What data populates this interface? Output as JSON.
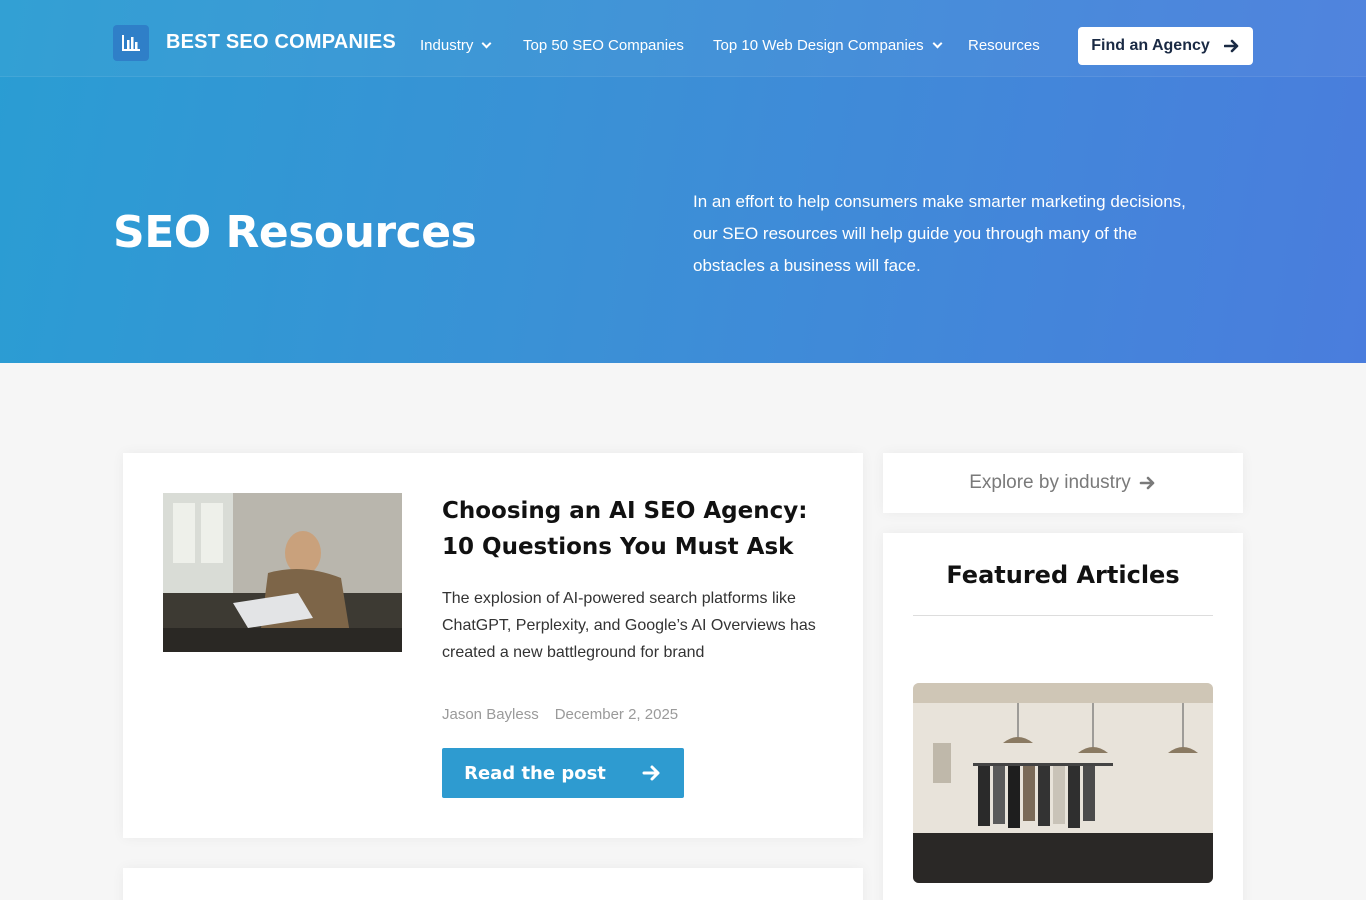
{
  "brand": {
    "name": "BEST SEO COMPANIES"
  },
  "nav": {
    "items": [
      {
        "label": "Industry",
        "dropdown": true
      },
      {
        "label": "Top 50 SEO Companies",
        "dropdown": false
      },
      {
        "label": "Top 10 Web Design Companies",
        "dropdown": true
      },
      {
        "label": "Resources",
        "dropdown": false
      }
    ],
    "cta_label": "Find an Agency"
  },
  "hero": {
    "title": "SEO Resources",
    "description": "In an effort to help consumers make smarter marketing decisions, our SEO resources will help guide you through many of the obstacles a business will face."
  },
  "post": {
    "title": "Choosing an AI SEO Agency: 10 Questions You Must Ask",
    "excerpt": "The explosion of AI-powered search platforms like ChatGPT, Perplexity, and Google’s AI Overviews has created a new battleground for brand",
    "author": "Jason Bayless",
    "date": "December 2, 2025",
    "button_label": "Read the post"
  },
  "sidebar": {
    "explore_label": "Explore by industry",
    "featured_title": "Featured Articles"
  },
  "colors": {
    "hero_start": "#2a9dd3",
    "hero_end": "#4a7ddd",
    "button_blue": "#2e9bd0",
    "logo_box": "#2f7fc8"
  },
  "icons": [
    "bar-chart-icon",
    "chevron-down-icon",
    "arrow-right-icon"
  ]
}
